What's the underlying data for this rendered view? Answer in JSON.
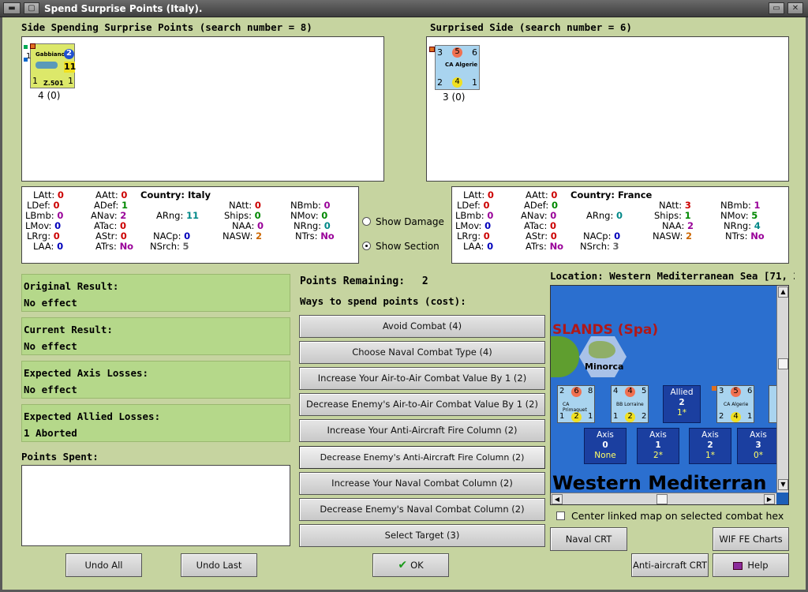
{
  "window": {
    "title": "Spend Surprise Points (Italy)."
  },
  "spending_side": {
    "header": "Side Spending Surprise Points (search number = 8)",
    "unit": {
      "name": "Gabbiano",
      "id": "Z.501",
      "top_right": "2",
      "mid_right": "11",
      "bottom_left": "1",
      "bottom_right": "1",
      "left_num": "1"
    },
    "unit_caption": "4 (0)"
  },
  "surprised_side": {
    "header": "Surprised Side (search number = 6)",
    "unit": {
      "name": "CA Algerie",
      "tl": "3",
      "tm": "5",
      "tr": "6",
      "bl": "2",
      "bm": "4",
      "br": "1"
    },
    "unit_caption": "3 (0)"
  },
  "stats_left": {
    "country": "Country: Italy",
    "LAtt": "0",
    "LDef": "0",
    "LBmb": "0",
    "LMov": "0",
    "LRrg": "0",
    "LAA": "0",
    "AAtt": "0",
    "ADef": "1",
    "ANav": "2",
    "ATac": "0",
    "AStr": "0",
    "ATrs": "No",
    "ARng": "11",
    "NACp": "0",
    "NSrch": "5",
    "NAtt": "0",
    "Ships": "0",
    "NAA": "0",
    "NASW": "2",
    "NBmb": "0",
    "NMov": "0",
    "NRng": "0",
    "NTrs": "No"
  },
  "stats_right": {
    "country": "Country: France",
    "LAtt": "0",
    "LDef": "0",
    "LBmb": "0",
    "LMov": "0",
    "LRrg": "0",
    "LAA": "0",
    "AAtt": "0",
    "ADef": "0",
    "ANav": "0",
    "ATac": "0",
    "AStr": "0",
    "ATrs": "No",
    "ARng": "0",
    "NACp": "0",
    "NSrch": "3",
    "NAtt": "3",
    "Ships": "1",
    "NAA": "2",
    "NASW": "2",
    "NBmb": "1",
    "NMov": "5",
    "NRng": "4",
    "NTrs": "No"
  },
  "radio": {
    "show_damage": "Show Damage",
    "show_section": "Show Section",
    "selected": "show_section"
  },
  "results": [
    {
      "label": "Original Result:",
      "value": "No effect"
    },
    {
      "label": "Current Result:",
      "value": "No effect"
    },
    {
      "label": "Expected Axis Losses:",
      "value": "No effect"
    },
    {
      "label": "Expected Allied Losses:",
      "value": "1 Aborted"
    }
  ],
  "points_spent_label": "Points Spent:",
  "points_remaining": {
    "label": "Points Remaining:",
    "value": "2"
  },
  "ways_label": "Ways to spend points (cost):",
  "options": [
    "Avoid Combat (4)",
    "Choose Naval Combat Type (4)",
    "Increase Your Air-to-Air Combat Value By 1 (2)",
    "Decrease Enemy's Air-to-Air Combat Value By 1 (2)",
    "Increase Your Anti-Aircraft Fire Column (2)",
    "Decrease Enemy's Anti-Aircraft Fire Column (2)",
    "Increase Your Naval Combat Column (2)",
    "Decrease Enemy's Naval Combat Column (2)",
    "Select Target (3)"
  ],
  "location": "Location: Western Mediterranean Sea [71, 2",
  "map": {
    "region_label": "SLANDS (Spa)",
    "island": "Minorca",
    "sea_label": "Western Mediterran",
    "counters": [
      {
        "name": "CA Primaguet",
        "tl": "2",
        "tm": "6",
        "tr": "8",
        "bl": "1",
        "bm": "2",
        "br": "1"
      },
      {
        "name": "BB Lorraine",
        "tl": "4",
        "tm": "4",
        "tr": "5",
        "bl": "1",
        "bm": "2",
        "br": "2"
      },
      {
        "name": "CA Algerie",
        "tl": "3",
        "tm": "5",
        "tr": "6",
        "bl": "2",
        "bm": "4",
        "br": "1"
      }
    ],
    "allied_box": {
      "title": "Allied",
      "value": "2",
      "sub": "1*"
    },
    "axis_boxes": [
      {
        "title": "Axis",
        "value": "0",
        "sub": "None"
      },
      {
        "title": "Axis",
        "value": "1",
        "sub": "2*"
      },
      {
        "title": "Axis",
        "value": "2",
        "sub": "1*"
      },
      {
        "title": "Axis",
        "value": "3",
        "sub": "0*"
      }
    ]
  },
  "center_checkbox": "Center linked map on selected combat hex",
  "buttons": {
    "undo_all": "Undo All",
    "undo_last": "Undo Last",
    "ok": "OK",
    "naval_crt": "Naval CRT",
    "wif_charts": "WIF FE Charts",
    "aa_crt": "Anti-aircraft CRT",
    "help": "Help"
  }
}
